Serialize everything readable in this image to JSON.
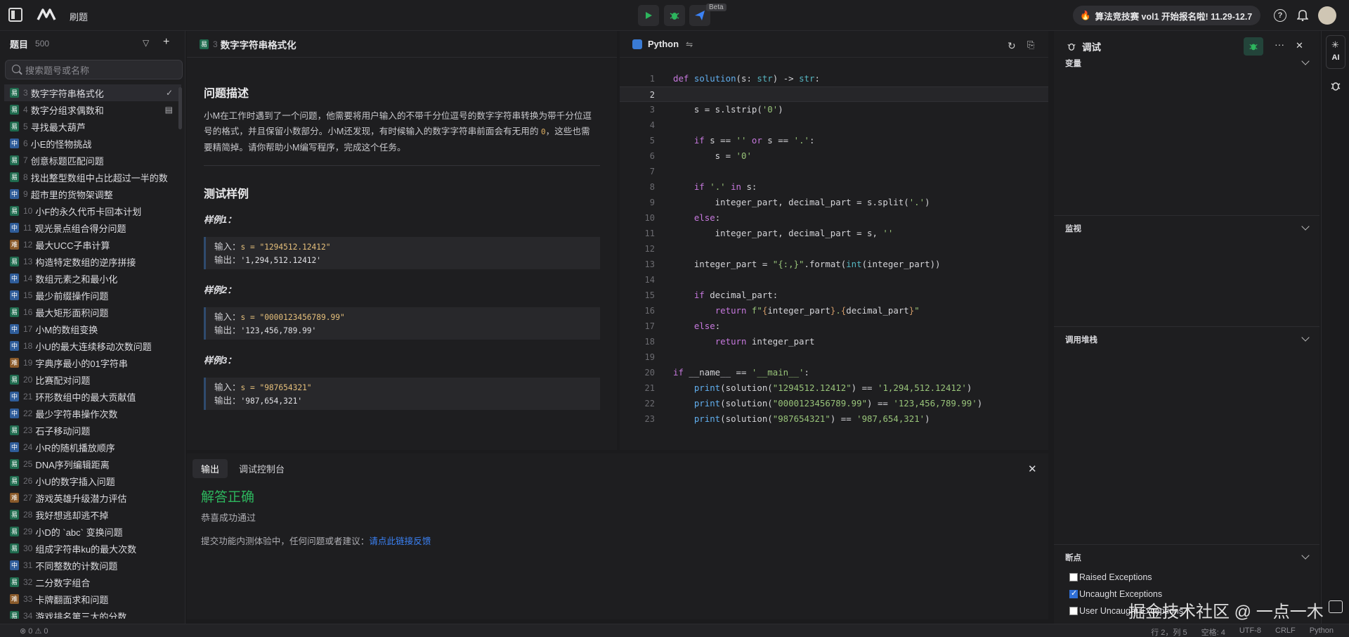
{
  "topbar": {
    "nav_label": "刷题",
    "beta": "Beta",
    "promo": "算法竞技赛 vol1 开始报名啦! 11.29-12.7"
  },
  "sidebar": {
    "title": "题目",
    "count": "500",
    "search_placeholder": "搜索题号或名称",
    "problems": [
      {
        "level": "易",
        "num": "3",
        "title": "数字字符串格式化",
        "mark": "✓"
      },
      {
        "level": "易",
        "num": "4",
        "title": "数字分组求偶数和",
        "mark": "▤"
      },
      {
        "level": "易",
        "num": "5",
        "title": "寻找最大葫芦",
        "mark": ""
      },
      {
        "level": "中",
        "num": "6",
        "title": "小E的怪物挑战",
        "mark": ""
      },
      {
        "level": "易",
        "num": "7",
        "title": "创意标题匹配问题",
        "mark": ""
      },
      {
        "level": "易",
        "num": "8",
        "title": "找出整型数组中占比超过一半的数",
        "mark": ""
      },
      {
        "level": "中",
        "num": "9",
        "title": "超市里的货物架调整",
        "mark": ""
      },
      {
        "level": "易",
        "num": "10",
        "title": "小F的永久代币卡回本计划",
        "mark": ""
      },
      {
        "level": "中",
        "num": "11",
        "title": "观光景点组合得分问题",
        "mark": ""
      },
      {
        "level": "难",
        "num": "12",
        "title": "最大UCC子串计算",
        "mark": ""
      },
      {
        "level": "易",
        "num": "13",
        "title": "构造特定数组的逆序拼接",
        "mark": ""
      },
      {
        "level": "中",
        "num": "14",
        "title": "数组元素之和最小化",
        "mark": ""
      },
      {
        "level": "中",
        "num": "15",
        "title": "最少前缀操作问题",
        "mark": ""
      },
      {
        "level": "易",
        "num": "16",
        "title": "最大矩形面积问题",
        "mark": ""
      },
      {
        "level": "中",
        "num": "17",
        "title": "小M的数组变换",
        "mark": ""
      },
      {
        "level": "中",
        "num": "18",
        "title": "小U的最大连续移动次数问题",
        "mark": ""
      },
      {
        "level": "难",
        "num": "19",
        "title": "字典序最小的01字符串",
        "mark": ""
      },
      {
        "level": "易",
        "num": "20",
        "title": "比赛配对问题",
        "mark": ""
      },
      {
        "level": "中",
        "num": "21",
        "title": "环形数组中的最大贡献值",
        "mark": ""
      },
      {
        "level": "中",
        "num": "22",
        "title": "最少字符串操作次数",
        "mark": ""
      },
      {
        "level": "易",
        "num": "23",
        "title": "石子移动问题",
        "mark": ""
      },
      {
        "level": "中",
        "num": "24",
        "title": "小R的随机播放顺序",
        "mark": ""
      },
      {
        "level": "易",
        "num": "25",
        "title": "DNA序列编辑距离",
        "mark": ""
      },
      {
        "level": "易",
        "num": "26",
        "title": "小U的数字插入问题",
        "mark": ""
      },
      {
        "level": "难",
        "num": "27",
        "title": "游戏英雄升级潜力评估",
        "mark": ""
      },
      {
        "level": "易",
        "num": "28",
        "title": "我好想逃却逃不掉",
        "mark": ""
      },
      {
        "level": "易",
        "num": "29",
        "title": "小D的 `abc` 变换问题",
        "mark": ""
      },
      {
        "level": "易",
        "num": "30",
        "title": "组成字符串ku的最大次数",
        "mark": ""
      },
      {
        "level": "中",
        "num": "31",
        "title": "不同整数的计数问题",
        "mark": ""
      },
      {
        "level": "易",
        "num": "32",
        "title": "二分数字组合",
        "mark": ""
      },
      {
        "level": "难",
        "num": "33",
        "title": "卡牌翻面求和问题",
        "mark": ""
      },
      {
        "level": "易",
        "num": "34",
        "title": "游戏排名第三大的分数",
        "mark": ""
      }
    ]
  },
  "description": {
    "level": "易",
    "num": "3",
    "title": "数字字符串格式化",
    "section_problem": "问题描述",
    "para_before_code": "小M在工作时遇到了一个问题，他需要将用户输入的不带千分位逗号的数字字符串转换为带千分位逗号的格式，并且保留小数部分。小M还发现，有时候输入的数字字符串前面会有无用的 ",
    "para_code": "0",
    "para_after_code": "，这些也需要精简掉。请你帮助小M编写程序，完成这个任务。",
    "section_examples": "测试样例",
    "input_label": "输入：",
    "output_label": "输出：",
    "examples": [
      {
        "label": "样例1：",
        "input": "s = \"1294512.12412\"",
        "output": "'1,294,512.12412'"
      },
      {
        "label": "样例2：",
        "input": "s = \"0000123456789.99\"",
        "output": "'123,456,789.99'"
      },
      {
        "label": "样例3：",
        "input": "s = \"987654321\"",
        "output": "'987,654,321'"
      }
    ]
  },
  "editor": {
    "language": "Python",
    "current_line": 2,
    "lines": [
      {
        "n": "1",
        "html": "<span class=\"kw\">def</span> <span class=\"fn\">solution</span>(s: <span class=\"ty\">str</span>) -> <span class=\"ty\">str</span>:"
      },
      {
        "n": "2",
        "html": ""
      },
      {
        "n": "3",
        "html": "    s = s.lstrip(<span class=\"st\">'0'</span>)"
      },
      {
        "n": "4",
        "html": ""
      },
      {
        "n": "5",
        "html": "    <span class=\"kw\">if</span> s == <span class=\"st\">''</span> <span class=\"kw\">or</span> s == <span class=\"st\">'.'</span>:"
      },
      {
        "n": "6",
        "html": "        s = <span class=\"st\">'0'</span>"
      },
      {
        "n": "7",
        "html": ""
      },
      {
        "n": "8",
        "html": "    <span class=\"kw\">if</span> <span class=\"st\">'.'</span> <span class=\"kw\">in</span> s:"
      },
      {
        "n": "9",
        "html": "        integer_part, decimal_part = s.split(<span class=\"st\">'.'</span>)"
      },
      {
        "n": "10",
        "html": "    <span class=\"kw\">else</span>:"
      },
      {
        "n": "11",
        "html": "        integer_part, decimal_part = s, <span class=\"st\">''</span>"
      },
      {
        "n": "12",
        "html": ""
      },
      {
        "n": "13",
        "html": "    integer_part = <span class=\"st\">\"{:,}\"</span>.format(<span class=\"ty\">int</span>(integer_part))"
      },
      {
        "n": "14",
        "html": ""
      },
      {
        "n": "15",
        "html": "    <span class=\"kw\">if</span> decimal_part:"
      },
      {
        "n": "16",
        "html": "        <span class=\"kw\">return</span> <span class=\"st\">f\"</span><span class=\"sp\">{</span>integer_part<span class=\"sp\">}</span><span class=\"st\">.</span><span class=\"sp\">{</span>decimal_part<span class=\"sp\">}</span><span class=\"st\">\"</span>"
      },
      {
        "n": "17",
        "html": "    <span class=\"kw\">else</span>:"
      },
      {
        "n": "18",
        "html": "        <span class=\"kw\">return</span> integer_part"
      },
      {
        "n": "19",
        "html": ""
      },
      {
        "n": "20",
        "html": "<span class=\"kw\">if</span> __name__ == <span class=\"st\">'__main__'</span>:"
      },
      {
        "n": "21",
        "html": "    <span class=\"fn\">print</span>(solution(<span class=\"st\">\"1294512.12412\"</span>) == <span class=\"st\">'1,294,512.12412'</span>)"
      },
      {
        "n": "22",
        "html": "    <span class=\"fn\">print</span>(solution(<span class=\"st\">\"0000123456789.99\"</span>) == <span class=\"st\">'123,456,789.99'</span>)"
      },
      {
        "n": "23",
        "html": "    <span class=\"fn\">print</span>(solution(<span class=\"st\">\"987654321\"</span>) == <span class=\"st\">'987,654,321'</span>)"
      }
    ]
  },
  "output": {
    "tabs": [
      "输出",
      "调试控制台"
    ],
    "result_title": "解答正确",
    "result_sub": "恭喜成功通过",
    "feedback_text": "提交功能内测体验中，任何问题或者建议：",
    "feedback_link": "请点此链接反馈"
  },
  "debug": {
    "title": "调试",
    "sections": [
      "变量",
      "监视",
      "调用堆栈",
      "断点"
    ],
    "breakpoints": [
      {
        "label": "Raised Exceptions",
        "checked": false
      },
      {
        "label": "Uncaught Exceptions",
        "checked": true
      },
      {
        "label": "User Uncaught Exceptions",
        "checked": false
      }
    ]
  },
  "rail": {
    "ai_label": "AI"
  },
  "status": {
    "left": "⊗ 0 ⚠ 0",
    "line_col": "行 2，列 5",
    "spaces": "空格: 4",
    "encoding": "UTF-8",
    "eol": "CRLF",
    "language": "Python"
  },
  "watermark": "掘金技术社区 @ 一点一木",
  "colors": {
    "accent_green": "#2db55d",
    "link_blue": "#3b82f6",
    "easy": "#1f6b4e",
    "medium": "#2f5d9a",
    "hard": "#8a5a2a"
  }
}
